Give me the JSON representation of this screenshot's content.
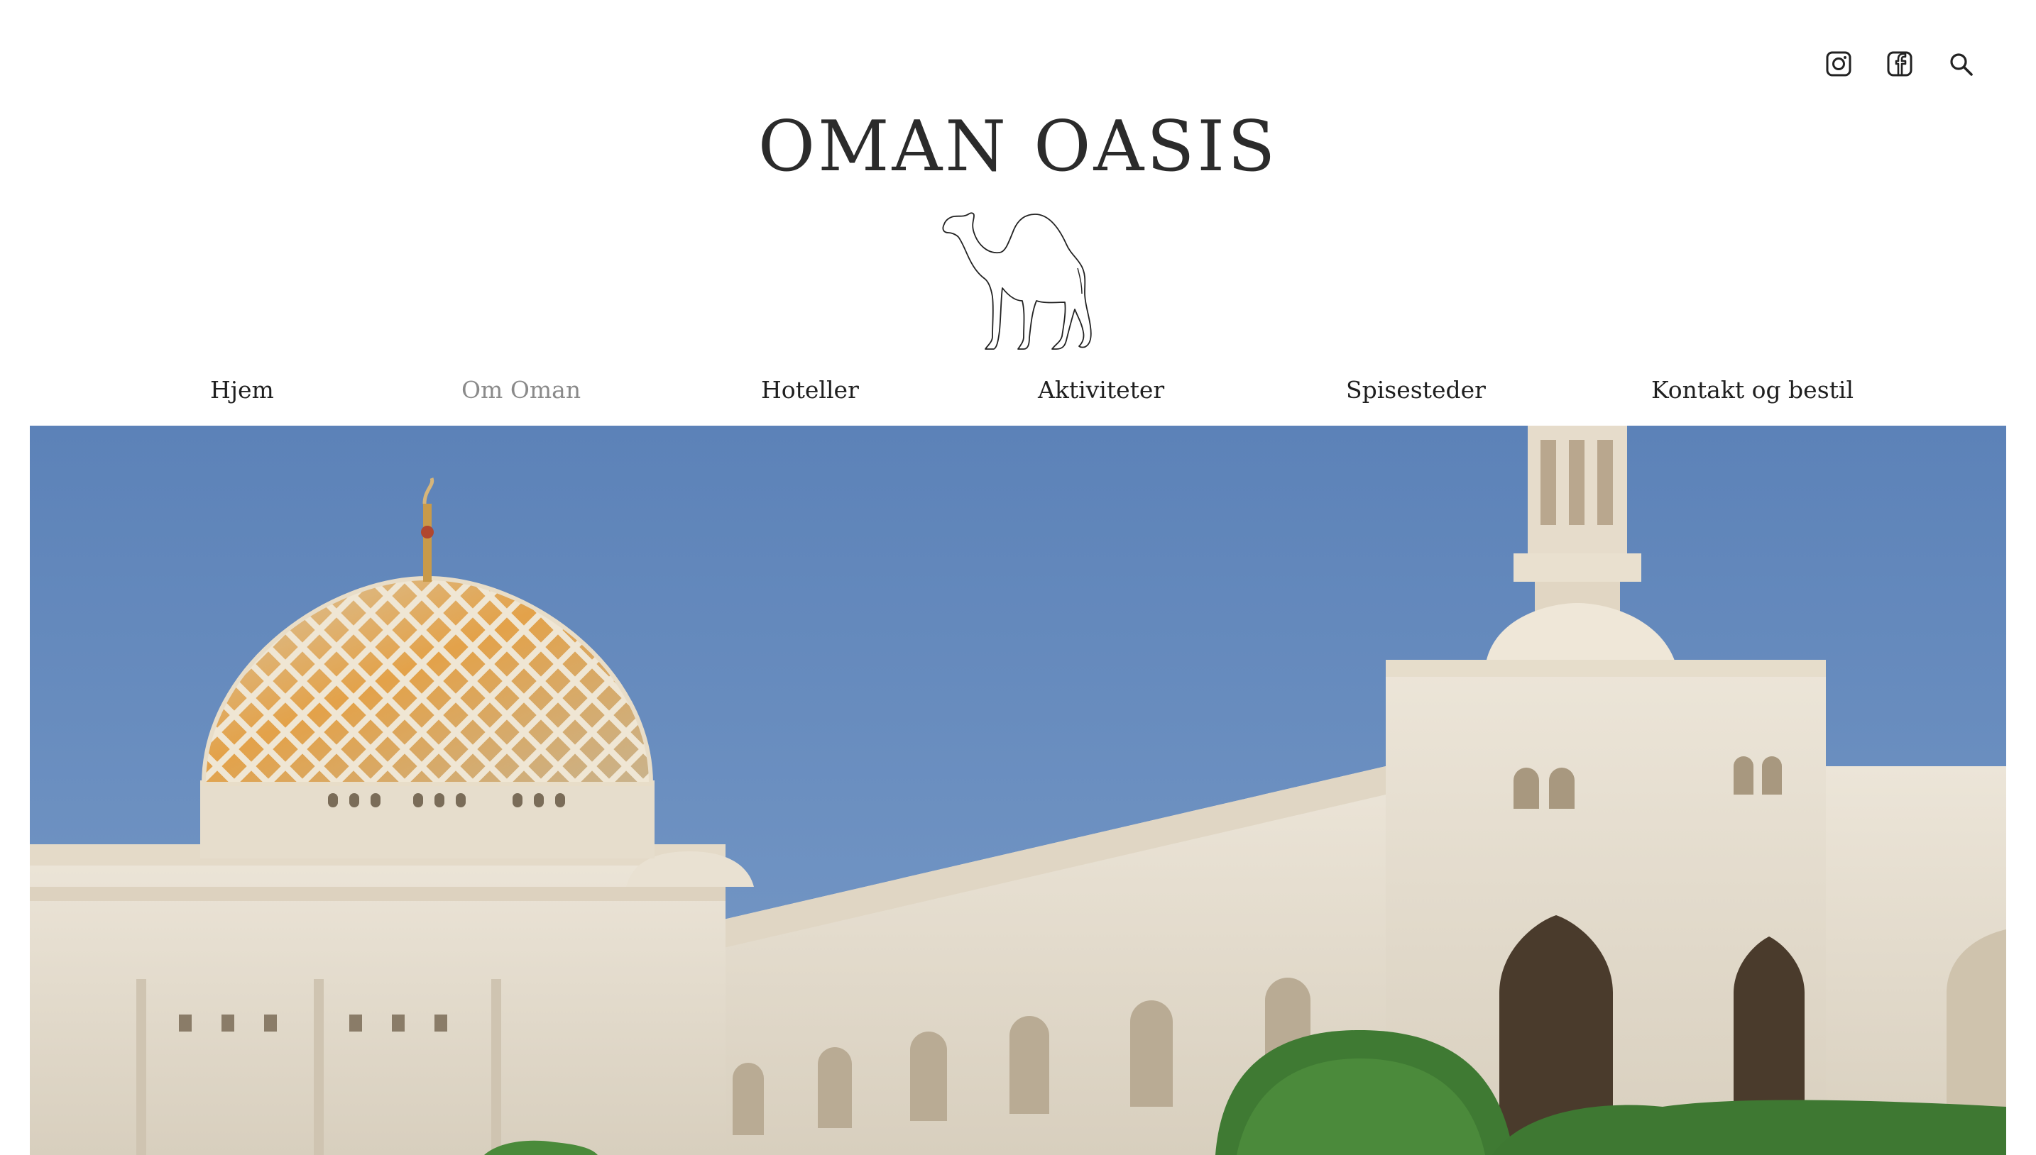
{
  "site": {
    "title": "OMAN OASIS",
    "logo_icon": "camel-icon"
  },
  "social": {
    "instagram_icon": "instagram-icon",
    "facebook_icon": "facebook-icon",
    "search_icon": "search-icon"
  },
  "nav": {
    "items": [
      {
        "label": "Hjem"
      },
      {
        "label": "Om Oman"
      },
      {
        "label": "Hoteller"
      },
      {
        "label": "Aktiviteter"
      },
      {
        "label": "Spisesteder"
      },
      {
        "label": "Kontakt og bestil"
      }
    ],
    "active_index": 1,
    "active_color": "#8a8a8a",
    "text_color": "#1f1f1f"
  },
  "hero": {
    "image_subject": "Sultan Qaboos Grand Mosque",
    "sky_color": "#6b8fbf",
    "stone_color": "#e8e0d2"
  }
}
